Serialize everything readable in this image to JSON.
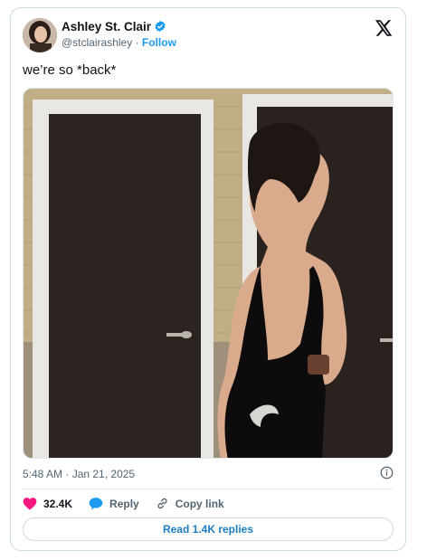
{
  "author": {
    "name": "Ashley St. Clair",
    "handle": "@stclairashley",
    "separator": "·",
    "follow_label": "Follow"
  },
  "tweet": {
    "text": "we’re so *back*",
    "timestamp": "5:48 AM · Jan 21, 2025"
  },
  "actions": {
    "likes": "32.4K",
    "reply_label": "Reply",
    "copy_label": "Copy link"
  },
  "read_replies_label": "Read 1.4K replies",
  "colors": {
    "accent": "#1d9bf0",
    "like": "#f91880",
    "muted": "#536471",
    "border": "#cfd9de"
  },
  "icons": [
    "verified-badge-icon",
    "x-logo-icon",
    "info-icon",
    "heart-icon",
    "reply-bubble-icon",
    "link-icon"
  ]
}
